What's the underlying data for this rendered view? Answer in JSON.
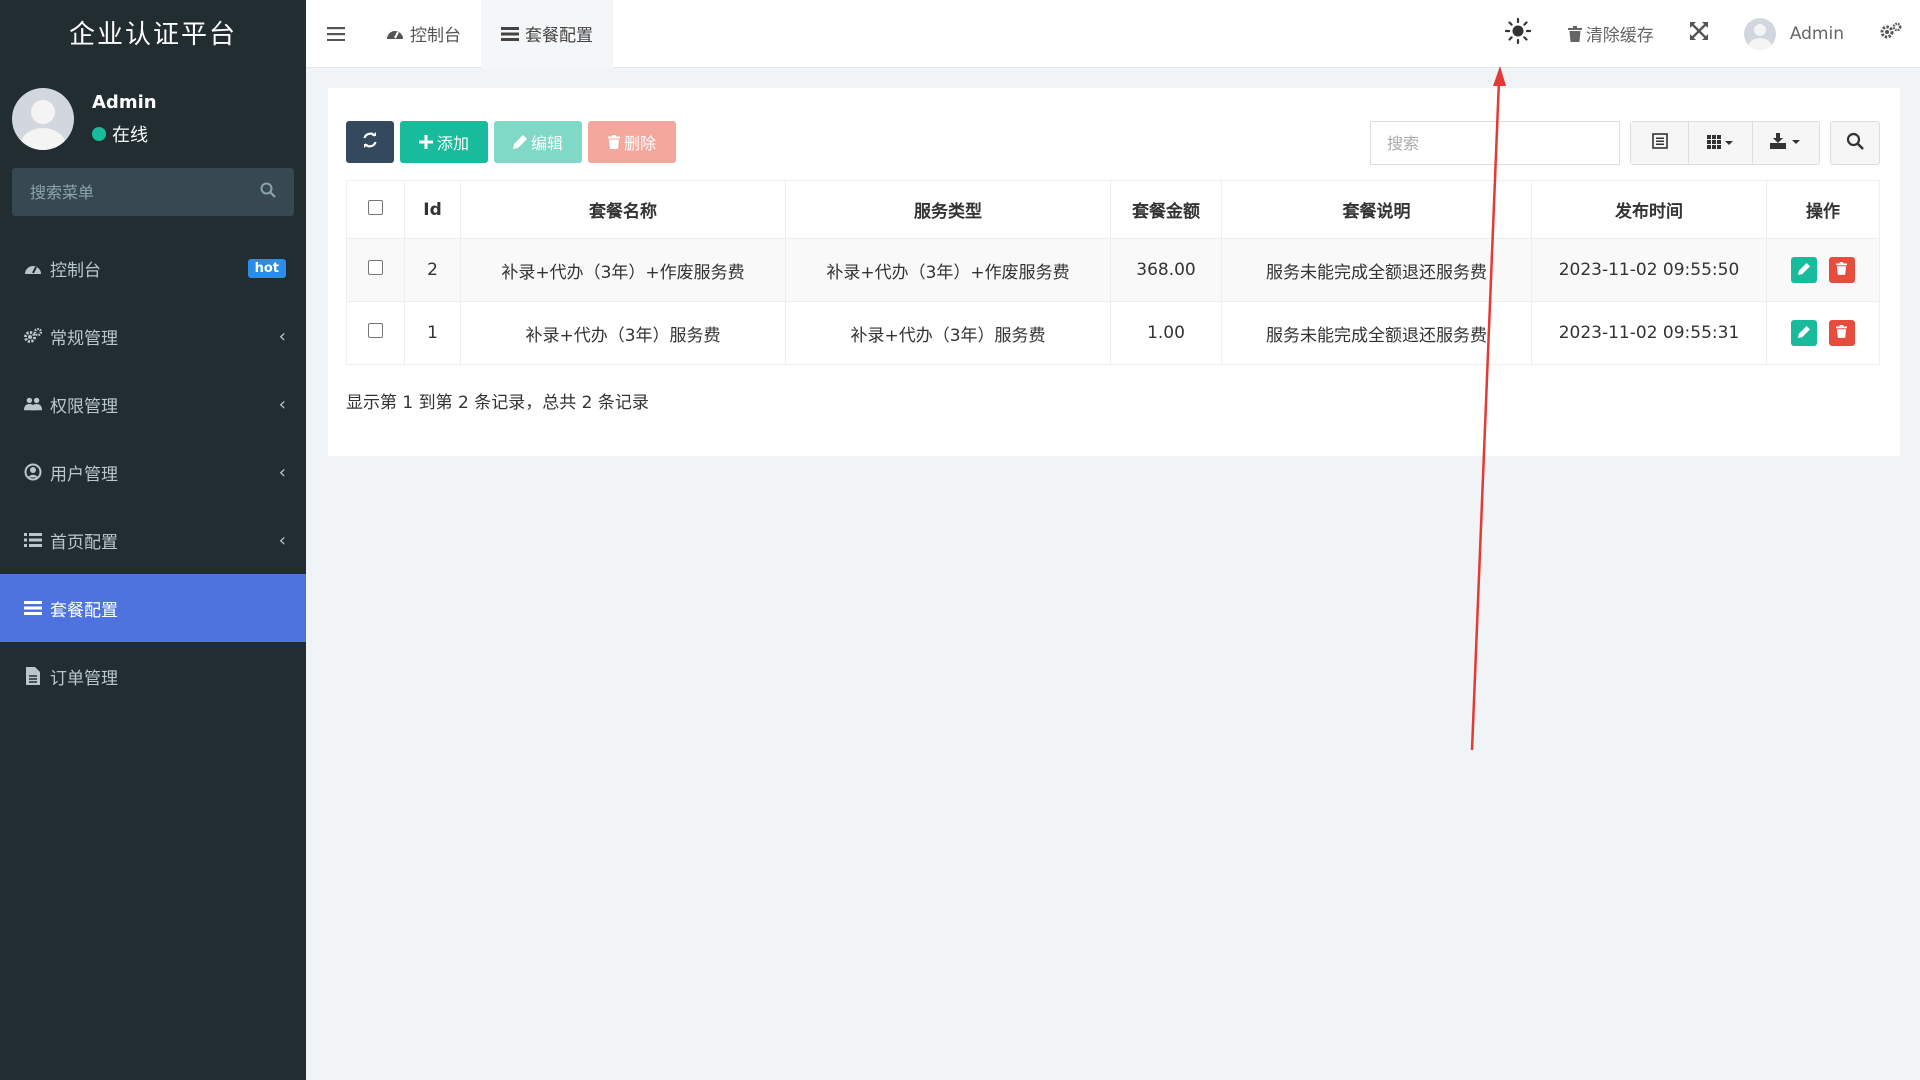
{
  "sidebar": {
    "logo": "企业认证平台",
    "user": {
      "name": "Admin",
      "status": "在线"
    },
    "search_placeholder": "搜索菜单",
    "items": [
      {
        "label": "控制台",
        "icon": "dashboard-icon",
        "badge": "hot"
      },
      {
        "label": "常规管理",
        "icon": "cogs-icon"
      },
      {
        "label": "权限管理",
        "icon": "group-icon"
      },
      {
        "label": "用户管理",
        "icon": "user-circle-icon"
      },
      {
        "label": "首页配置",
        "icon": "list-icon"
      },
      {
        "label": "套餐配置",
        "icon": "list-icon",
        "active": true
      },
      {
        "label": "订单管理",
        "icon": "file-icon"
      }
    ]
  },
  "header": {
    "tabs": [
      {
        "label": "控制台",
        "icon": "dashboard-icon"
      },
      {
        "label": "套餐配置",
        "icon": "list-icon",
        "active": true
      }
    ],
    "clear_cache": "清除缓存",
    "user": "Admin"
  },
  "toolbar": {
    "add_label": "添加",
    "edit_label": "编辑",
    "delete_label": "删除",
    "search_placeholder": "搜索"
  },
  "table": {
    "columns": [
      "Id",
      "套餐名称",
      "服务类型",
      "套餐金额",
      "套餐说明",
      "发布时间",
      "操作"
    ],
    "rows": [
      {
        "id": "2",
        "name": "补录+代办（3年）+作废服务费",
        "type": "补录+代办（3年）+作废服务费",
        "amount": "368.00",
        "desc": "服务未能完成全额退还服务费",
        "time": "2023-11-02 09:55:50"
      },
      {
        "id": "1",
        "name": "补录+代办（3年）服务费",
        "type": "补录+代办（3年）服务费",
        "amount": "1.00",
        "desc": "服务未能完成全额退还服务费",
        "time": "2023-11-02 09:55:31"
      }
    ]
  },
  "pager": {
    "text": "显示第 1 到第 2 条记录，总共 2 条记录"
  },
  "colors": {
    "sidebar_bg": "#222d32",
    "active": "#4e73df",
    "success": "#18bc9c",
    "danger": "#e74c3c",
    "annotation": "#e53935"
  }
}
